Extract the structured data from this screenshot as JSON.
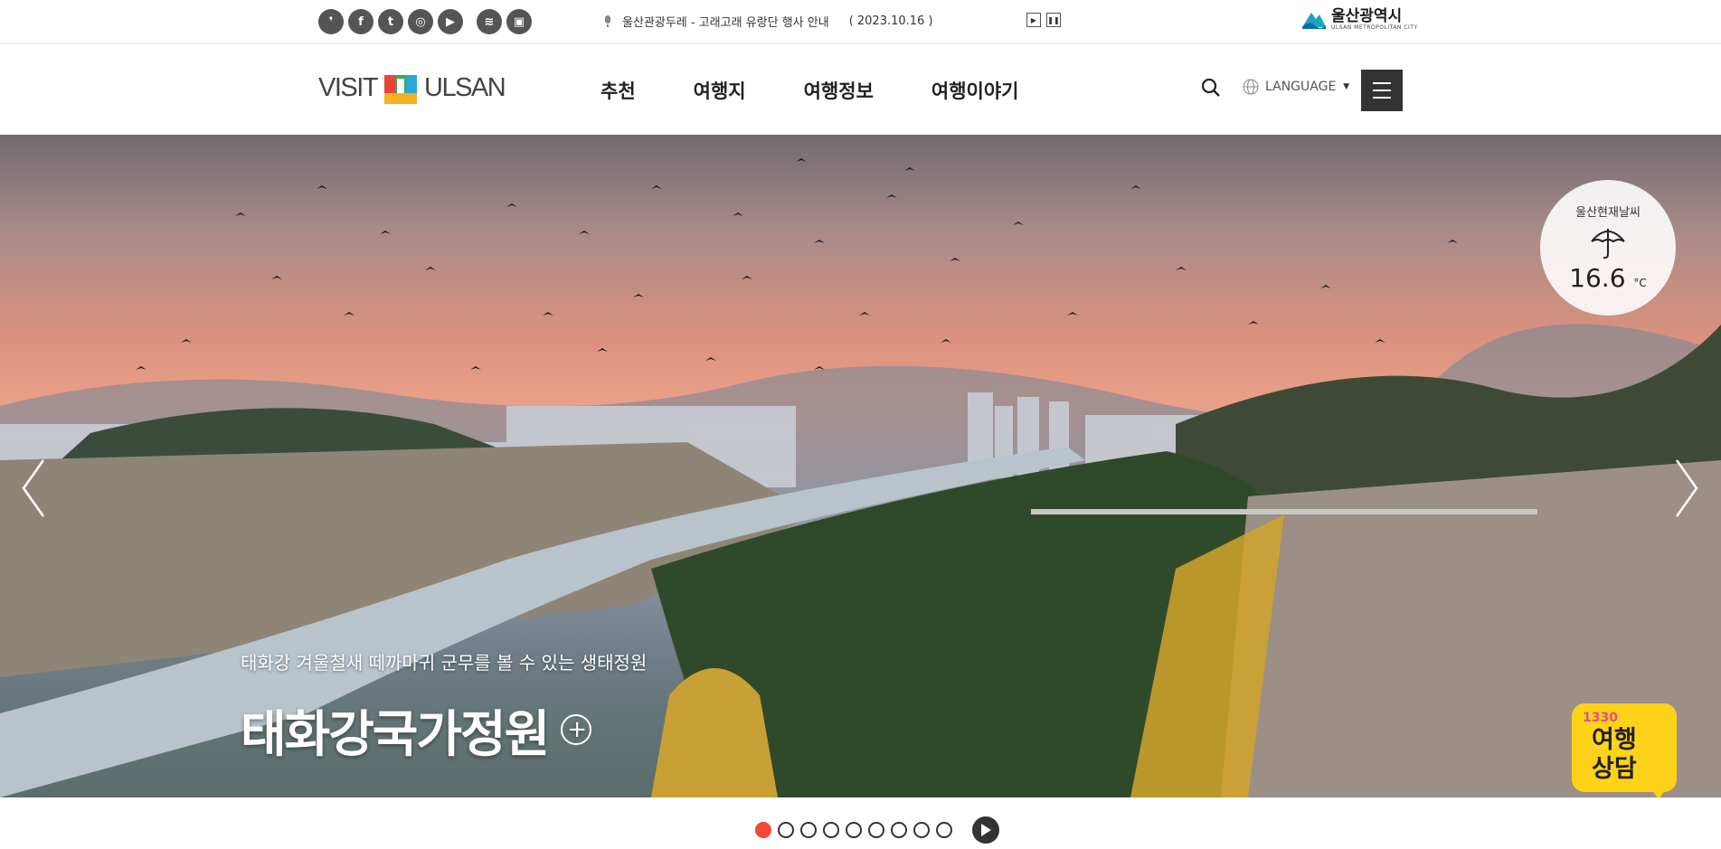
{
  "topbar": {
    "sns": [
      {
        "icon": "blog-icon",
        "glyph": "❜"
      },
      {
        "icon": "facebook-icon",
        "glyph": "f"
      },
      {
        "icon": "twitter-icon",
        "glyph": "t"
      },
      {
        "icon": "instagram-icon",
        "glyph": "◎"
      },
      {
        "icon": "youtube-icon",
        "glyph": "▶"
      },
      {
        "icon": "wifi-icon",
        "glyph": "≋"
      },
      {
        "icon": "bus-icon",
        "glyph": "▣"
      }
    ],
    "notice_text": "울산관광두레 - 고래고래 유랑단 행사 안내",
    "notice_date": "( 2023.10.16 )",
    "play_glyph": "▶",
    "pause_glyph": "❚❚",
    "city_name": "울산광역시",
    "city_name_en": "ULSAN METROPOLITAN CITY"
  },
  "header": {
    "logo_left": "VISIT",
    "logo_right": "ULSAN",
    "nav": [
      "추천",
      "여행지",
      "여행정보",
      "여행이야기"
    ],
    "language_label": "LANGUAGE",
    "caret": "▼"
  },
  "hero": {
    "subtitle": "태화강 겨울철새 떼까마귀 군무를 볼 수 있는 생태정원",
    "title": "태화강국가정원",
    "plus": "+",
    "weather_label": "울산현재날씨",
    "weather_temp": "16.6",
    "weather_unit": "°C",
    "consult_num": "1330",
    "consult_line1": "여행",
    "consult_line2": "상담"
  },
  "pager": {
    "count": 9,
    "active": 0
  },
  "colors": {
    "accent": "#ef4b33",
    "menu_bg": "#333333",
    "consult_bg": "#ffd21a"
  }
}
